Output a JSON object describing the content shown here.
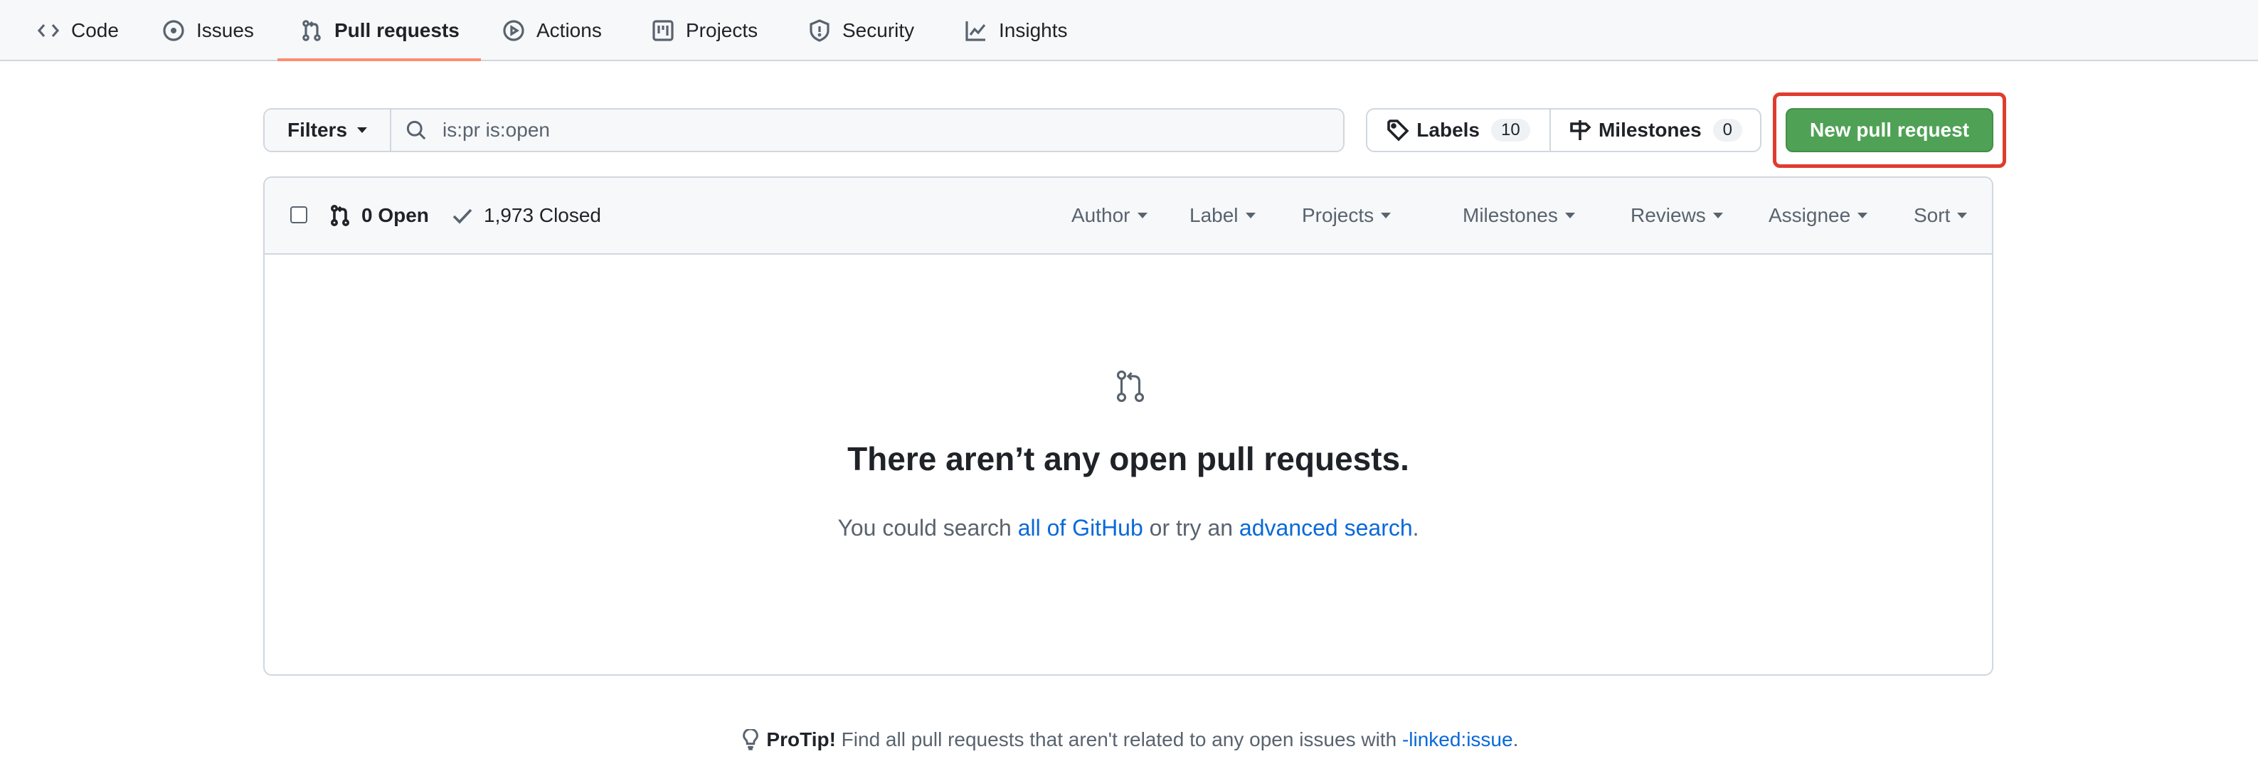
{
  "nav": {
    "items": [
      {
        "label": "Code",
        "icon": "code-icon"
      },
      {
        "label": "Issues",
        "icon": "issue-icon"
      },
      {
        "label": "Pull requests",
        "icon": "pull-request-icon",
        "active": true
      },
      {
        "label": "Actions",
        "icon": "play-icon"
      },
      {
        "label": "Projects",
        "icon": "project-icon"
      },
      {
        "label": "Security",
        "icon": "shield-icon"
      },
      {
        "label": "Insights",
        "icon": "graph-icon"
      }
    ],
    "active_underline_color": "#fd8c73"
  },
  "filter": {
    "filters_label": "Filters",
    "search_value": "is:pr is:open"
  },
  "labels": {
    "label": "Labels",
    "count": "10"
  },
  "milestones": {
    "label": "Milestones",
    "count": "0"
  },
  "new_pr": {
    "label": "New pull request",
    "color": "#4fa155",
    "highlight_color": "#e03c2e"
  },
  "list_header": {
    "open": "0 Open",
    "closed": "1,973 Closed",
    "dropdowns": [
      "Author",
      "Label",
      "Projects",
      "Milestones",
      "Reviews",
      "Assignee",
      "Sort"
    ]
  },
  "blankslate": {
    "title": "There aren’t any open pull requests.",
    "desc_prefix": "You could search ",
    "link1": "all of GitHub",
    "desc_middle": " or try an ",
    "link2": "advanced search",
    "desc_suffix": "."
  },
  "protip": {
    "bold": "ProTip!",
    "text": " Find all pull requests that aren't related to any open issues with ",
    "link": "-linked:issue",
    "suffix": "."
  }
}
